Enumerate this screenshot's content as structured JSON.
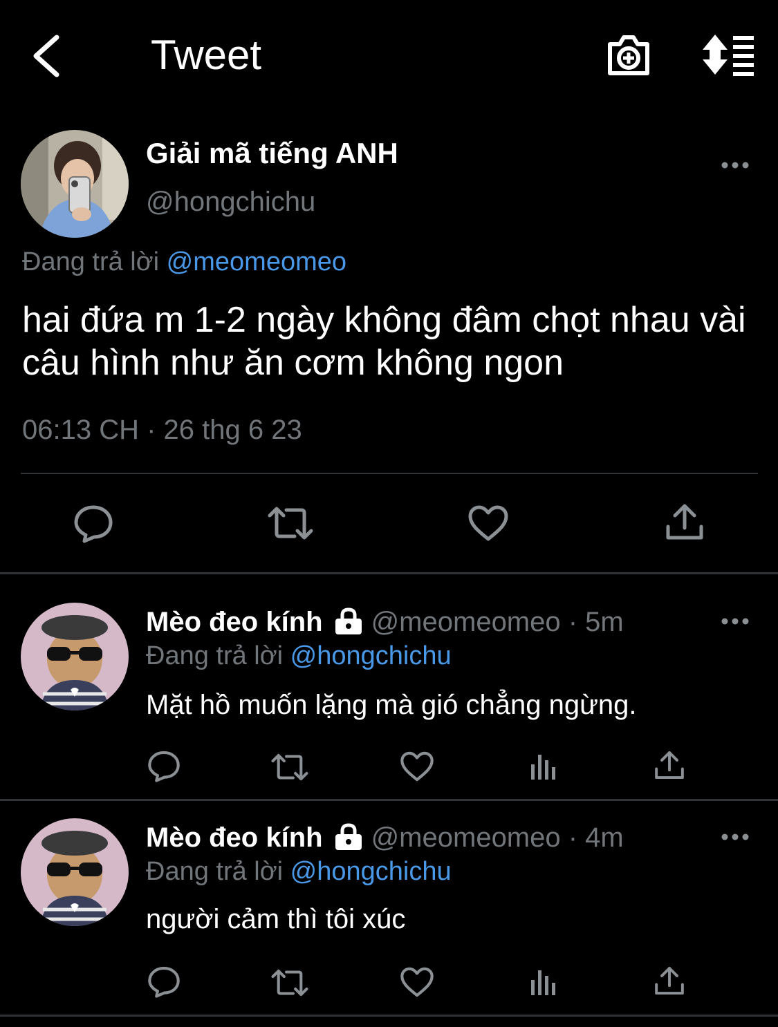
{
  "header": {
    "title": "Tweet"
  },
  "main_tweet": {
    "author_name": "Giải mã tiếng ANH",
    "handle": "@hongchichu",
    "replying_prefix": "Đang trả lời",
    "replying_to": "@meomeomeo",
    "text": "hai đứa m 1-2 ngày không đâm chọt nhau vài câu hình như ăn cơm không ngon",
    "timestamp": "06:13 CH · 26 thg 6 23"
  },
  "replies": [
    {
      "author_name": "Mèo đeo kính",
      "handle": "@meomeomeo",
      "time": "· 5m",
      "replying_prefix": "Đang trả lời",
      "replying_to": "@hongchichu",
      "text": "Mặt hồ muốn lặng mà gió chẳng ngừng."
    },
    {
      "author_name": "Mèo đeo kính",
      "handle": "@meomeomeo",
      "time": "· 4m",
      "replying_prefix": "Đang trả lời",
      "replying_to": "@hongchichu",
      "text": "người cảm thì tôi xúc"
    }
  ],
  "colors": {
    "background": "#000000",
    "text": "#ffffff",
    "muted": "#71767b",
    "link": "#4a99e9",
    "divider": "#2f3336"
  },
  "icons": [
    "back-arrow-icon",
    "camera-plus-icon",
    "sort-icon",
    "more-icon",
    "reply-icon",
    "retweet-icon",
    "like-icon",
    "analytics-icon",
    "share-icon",
    "lock-icon"
  ]
}
